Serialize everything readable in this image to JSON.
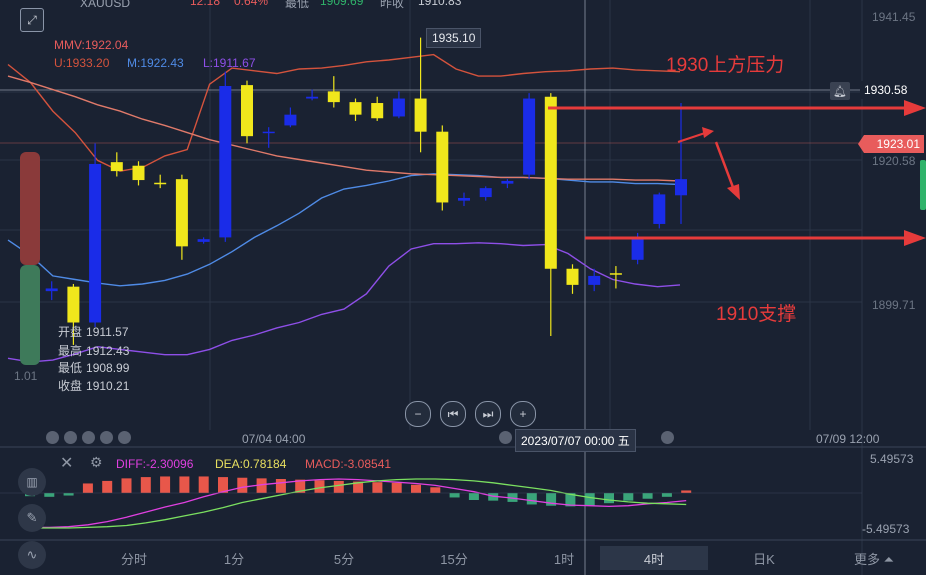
{
  "header": {
    "symbol": "XAUUSD",
    "change": "12.18",
    "change_pct": "0.64%",
    "low_label": "最低",
    "low_value": "1909.69",
    "prev_close_label": "昨收",
    "prev_close_value": "1910.83"
  },
  "indicators": {
    "mmv": "MMV:1922.04",
    "upper": "U:1933.20",
    "mid": "M:1922.43",
    "lower": "L:1911.67"
  },
  "price_axis": {
    "top": "1941.45",
    "alert_price": "1930.58",
    "current_price": "1923.01",
    "mid": "1920.58",
    "low": "1899.71",
    "left_edge": "1.01"
  },
  "crosshair": {
    "price": "1935.10",
    "time": "2023/07/07 00:00 五"
  },
  "annotations": {
    "resistance": "1930上方压力",
    "support": "1910支撑"
  },
  "ohlc": {
    "open_label": "开盘",
    "open": "1911.57",
    "high_label": "最高",
    "high": "1912.43",
    "low_label": "最低",
    "low": "1908.99",
    "close_label": "收盘",
    "close": "1910.21"
  },
  "time_axis": {
    "left": "07/04 04:00",
    "right": "07/09 12:00"
  },
  "macd": {
    "diff": "DIFF:-2.30096",
    "dea": "DEA:0.78184",
    "macd": "MACD:-3.08541",
    "top": "5.49573",
    "bottom": "-5.49573"
  },
  "timeframes": [
    "分时",
    "1分",
    "5分",
    "15分",
    "1时",
    "4时",
    "日K",
    "更多"
  ],
  "selected_timeframe": "4时",
  "colors": {
    "up": "#1a2ce8",
    "down": "#f0e71c",
    "upper_band": "#d4533d",
    "mid_band": "#4f8be6",
    "lower_band": "#8e4fe8",
    "annotation": "#e63b3b",
    "current_price_tag": "#e85c5c"
  },
  "chart_data": {
    "type": "candlestick",
    "x_start": "07/04 04:00",
    "interval": "4h",
    "y_range": [
      1895,
      1943
    ],
    "candles": [
      {
        "o": 1911.6,
        "h": 1912.4,
        "l": 1909.0,
        "c": 1910.2
      },
      {
        "o": 1910.5,
        "h": 1911.6,
        "l": 1909.5,
        "c": 1910.8
      },
      {
        "o": 1911.0,
        "h": 1911.3,
        "l": 1904.5,
        "c": 1907.0
      },
      {
        "o": 1907.0,
        "h": 1927.0,
        "l": 1906.5,
        "c": 1924.7
      },
      {
        "o": 1924.9,
        "h": 1926.0,
        "l": 1923.3,
        "c": 1923.9
      },
      {
        "o": 1924.5,
        "h": 1925.0,
        "l": 1922.3,
        "c": 1922.9
      },
      {
        "o": 1922.6,
        "h": 1923.5,
        "l": 1922.0,
        "c": 1922.5
      },
      {
        "o": 1923.0,
        "h": 1923.5,
        "l": 1914.0,
        "c": 1915.5
      },
      {
        "o": 1916.0,
        "h": 1916.5,
        "l": 1915.8,
        "c": 1916.3
      },
      {
        "o": 1916.5,
        "h": 1935.0,
        "l": 1916.0,
        "c": 1933.4
      },
      {
        "o": 1933.5,
        "h": 1934.0,
        "l": 1927.0,
        "c": 1927.8
      },
      {
        "o": 1928.2,
        "h": 1928.8,
        "l": 1926.5,
        "c": 1928.3
      },
      {
        "o": 1929.0,
        "h": 1931.0,
        "l": 1928.8,
        "c": 1930.2
      },
      {
        "o": 1932.0,
        "h": 1933.0,
        "l": 1931.8,
        "c": 1932.2
      },
      {
        "o": 1932.8,
        "h": 1934.5,
        "l": 1931.0,
        "c": 1931.6
      },
      {
        "o": 1931.6,
        "h": 1932.0,
        "l": 1929.5,
        "c": 1930.2
      },
      {
        "o": 1931.5,
        "h": 1932.2,
        "l": 1929.5,
        "c": 1929.8
      },
      {
        "o": 1930.0,
        "h": 1932.8,
        "l": 1929.8,
        "c": 1932.0
      },
      {
        "o": 1932.0,
        "h": 1938.8,
        "l": 1926.0,
        "c": 1928.3
      },
      {
        "o": 1928.3,
        "h": 1929.0,
        "l": 1919.5,
        "c": 1920.4
      },
      {
        "o": 1920.6,
        "h": 1921.5,
        "l": 1920.0,
        "c": 1920.9
      },
      {
        "o": 1921.0,
        "h": 1922.2,
        "l": 1920.6,
        "c": 1922.0
      },
      {
        "o": 1922.5,
        "h": 1923.0,
        "l": 1922.0,
        "c": 1922.8
      },
      {
        "o": 1923.5,
        "h": 1932.6,
        "l": 1923.0,
        "c": 1932.0
      },
      {
        "o": 1932.2,
        "h": 1932.6,
        "l": 1905.5,
        "c": 1913.0
      },
      {
        "o": 1913.0,
        "h": 1913.5,
        "l": 1910.2,
        "c": 1911.2
      },
      {
        "o": 1911.2,
        "h": 1913.0,
        "l": 1910.5,
        "c": 1912.2
      },
      {
        "o": 1912.5,
        "h": 1913.3,
        "l": 1910.8,
        "c": 1912.4
      },
      {
        "o": 1914.0,
        "h": 1917.0,
        "l": 1913.5,
        "c": 1916.5
      },
      {
        "o": 1918.0,
        "h": 1921.5,
        "l": 1917.5,
        "c": 1921.3
      },
      {
        "o": 1921.2,
        "h": 1931.5,
        "l": 1918.0,
        "c": 1923.0
      }
    ],
    "bands": {
      "upper": [
        1935.8,
        1933.8,
        1930.6,
        1928.2,
        1925.1,
        1923.9,
        1924.3,
        1925.6,
        1926.3,
        1933.6,
        1935.4,
        1935.1,
        1934.8,
        1935.3,
        1935.4,
        1935.7,
        1936.1,
        1936.3,
        1936.6,
        1936.9,
        1935.3,
        1934.5,
        1934.5,
        1934.8,
        1935.0,
        1935.1,
        1935.3,
        1935.4,
        1935.2,
        1935.1,
        1935.0
      ],
      "mid": [
        1916.2,
        1914.5,
        1912.2,
        1911.8,
        1911.4,
        1911.1,
        1911.3,
        1911.7,
        1912.4,
        1913.5,
        1914.9,
        1916.5,
        1917.8,
        1919.2,
        1920.9,
        1921.9,
        1922.3,
        1922.8,
        1923.4,
        1923.6,
        1923.5,
        1923.4,
        1923.2,
        1923.2,
        1923.1,
        1922.9,
        1922.7,
        1922.7,
        1922.5,
        1922.5,
        1922.4
      ],
      "lower": [
        1903.0,
        1902.6,
        1902.8,
        1903.5,
        1904.3,
        1904.0,
        1903.7,
        1903.4,
        1903.4,
        1904.0,
        1905.0,
        1905.6,
        1906.4,
        1907.0,
        1907.9,
        1908.5,
        1910.2,
        1913.3,
        1915.2,
        1915.8,
        1915.8,
        1915.9,
        1915.8,
        1915.6,
        1915.7,
        1914.7,
        1913.0,
        1911.8,
        1911.3,
        1911.0,
        1911.2
      ]
    },
    "ma_line": [
      1934.5,
      1933.8,
      1933.0,
      1932.2,
      1931.3,
      1930.6,
      1929.7,
      1929.0,
      1928.2,
      1927.4,
      1926.8,
      1926.2,
      1925.6,
      1925.2,
      1924.8,
      1924.4,
      1924.0,
      1923.8,
      1923.6,
      1923.5,
      1923.4,
      1923.3,
      1923.2,
      1923.2,
      1923.1,
      1923.0,
      1923.0,
      1923.0,
      1922.9,
      1922.9,
      1922.8
    ],
    "macd_hist": [
      -0.5,
      -0.6,
      -0.4,
      1.5,
      1.9,
      2.3,
      2.5,
      2.6,
      2.6,
      2.6,
      2.5,
      2.4,
      2.3,
      2.2,
      2.1,
      2.0,
      1.9,
      1.8,
      1.7,
      1.6,
      1.3,
      0.9,
      -0.7,
      -1.1,
      -1.2,
      -1.4,
      -1.8,
      -2.0,
      -2.1,
      -2.0,
      -1.6,
      -1.2,
      -0.9,
      -0.6,
      0.4
    ],
    "macd_diff": [
      -5.4,
      -5.4,
      -5.3,
      -5.0,
      -4.5,
      -3.8,
      -3.0,
      -2.2,
      -1.5,
      -0.6,
      0.2,
      0.9,
      1.3,
      1.6,
      1.9,
      2.1,
      2.2,
      2.1,
      1.9,
      1.7,
      1.5,
      1.2,
      0.7,
      0.2,
      -0.5,
      -0.8,
      -1.2,
      -1.6,
      -1.9,
      -2.0,
      -2.1,
      -2.0,
      -1.7,
      -1.5,
      -1.2
    ],
    "macd_dea": [
      -5.5,
      -5.5,
      -5.5,
      -5.4,
      -5.3,
      -5.1,
      -4.7,
      -4.2,
      -3.6,
      -3.0,
      -2.3,
      -1.5,
      -0.9,
      -0.3,
      0.3,
      0.8,
      1.2,
      1.6,
      1.9,
      2.1,
      2.2,
      2.2,
      2.1,
      1.9,
      1.6,
      1.2,
      0.8,
      0.4,
      -0.2,
      -0.7,
      -1.1,
      -1.4,
      -1.6,
      -1.7,
      -1.8
    ]
  }
}
